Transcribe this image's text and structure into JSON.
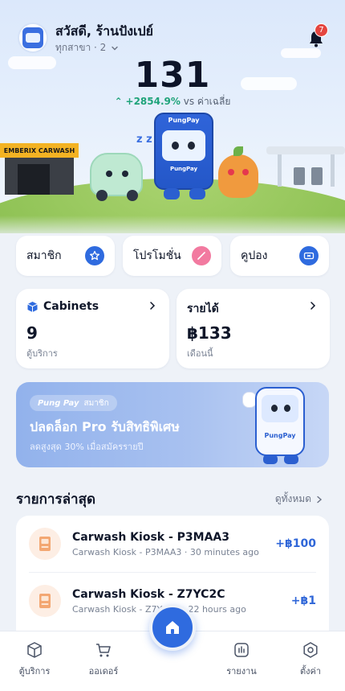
{
  "header": {
    "greeting": "สวัสดี, ร้านปังเปย์",
    "branch_label": "ทุกสาขา · 2",
    "notification_count": "7"
  },
  "hero": {
    "total": "131",
    "delta": "+2854.9%",
    "delta_suffix": "vs ค่าเฉลี่ย",
    "carwash_sign": "EMBERIX CARWASH",
    "mascot_name": "PungPay"
  },
  "quick_actions": [
    {
      "label": "สมาชิก",
      "icon": "star-icon",
      "color": "#2f6bdf"
    },
    {
      "label": "โปรโมชั่น",
      "icon": "tag-icon",
      "color": "#f27aa0"
    },
    {
      "label": "คูปอง",
      "icon": "ticket-icon",
      "color": "#2f6bdf"
    }
  ],
  "stats": {
    "cabinets": {
      "title": "Cabinets",
      "value": "9",
      "sub": "ตู้บริการ"
    },
    "revenue": {
      "title": "รายได้",
      "value": "฿133",
      "sub": "เดือนนี้"
    }
  },
  "promo": {
    "brand": "Pung Pay",
    "member": "สมาชิก",
    "title": "ปลดล็อก Pro รับสิทธิพิเศษ",
    "subtitle": "ลดสูงสุด 30% เมื่อสมัครรายปี",
    "mascot_label": "PungPay"
  },
  "recent": {
    "title": "รายการล่าสุด",
    "see_all": "ดูทั้งหมด",
    "items": [
      {
        "name": "Carwash Kiosk - P3MAA3",
        "meta": "Carwash Kiosk - P3MAA3 · 30 minutes ago",
        "amount": "+฿100"
      },
      {
        "name": "Carwash Kiosk - Z7YC2C",
        "meta": "Carwash Kiosk - Z7YC2C · 22 hours ago",
        "amount": "+฿1"
      }
    ]
  },
  "nav": {
    "cabinets": "ตู้บริการ",
    "orders": "ออเดอร์",
    "reports": "รายงาน",
    "settings": "ตั้งค่า"
  },
  "colors": {
    "accent": "#2f6bdf",
    "positive": "#1fa37a",
    "badge": "#e4453f"
  }
}
